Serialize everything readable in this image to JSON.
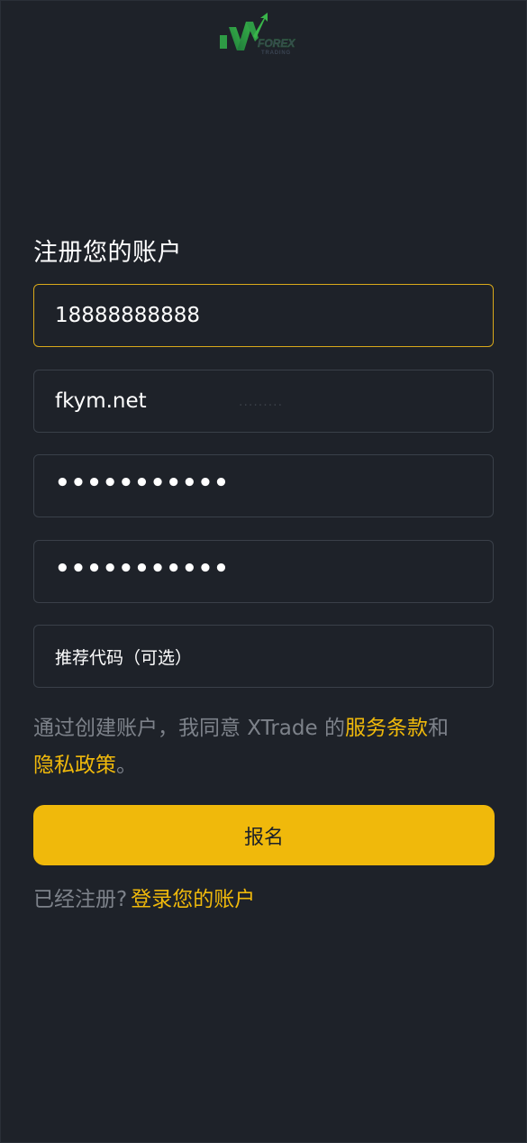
{
  "logo": {
    "brand_top": "FOREX",
    "brand_bottom": "TRADING"
  },
  "form": {
    "title": "注册您的账户",
    "phone_value": "18888888888",
    "site_value": "fkym.net",
    "ghost_text": "·········",
    "password_value": "•••••••••••",
    "confirm_password_value": "•••••••••••",
    "referral_placeholder": "推荐代码（可选）"
  },
  "terms": {
    "prefix": "通过创建账户，我同意 XTrade 的",
    "terms_link": "服务条款",
    "middle": "和",
    "privacy_link": "隐私政策",
    "suffix": "。"
  },
  "submit_label": "报名",
  "signin": {
    "prompt": "已经注册?",
    "link": "登录您的账户"
  },
  "colors": {
    "background": "#1e2229",
    "accent": "#f0b90b",
    "focus_border": "#d9a91a",
    "field_border": "#3a4049",
    "muted_text": "#7d828a"
  }
}
